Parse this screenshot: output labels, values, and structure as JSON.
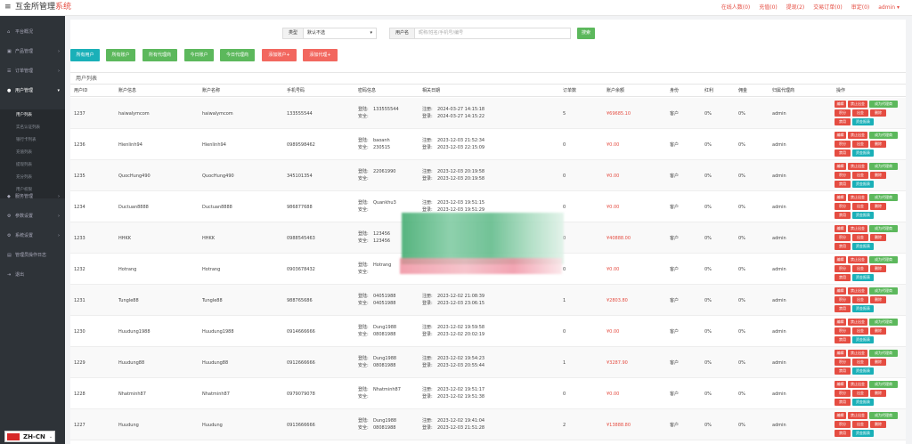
{
  "header": {
    "brand_main": "互金所管理",
    "brand_accent": "系统",
    "links": [
      "在线人数(0)",
      "充值(0)",
      "提现(2)",
      "交易订单(0)",
      "审定(0)"
    ],
    "user": "admin"
  },
  "sidebar": {
    "items": [
      {
        "label": "平台概况",
        "icon": "home-icon"
      },
      {
        "label": "产品管理",
        "icon": "box-icon"
      },
      {
        "label": "订单管理",
        "icon": "list-icon"
      },
      {
        "label": "用户管理",
        "icon": "user-icon"
      },
      {
        "label": "服务管理",
        "icon": "service-icon"
      },
      {
        "label": "参数设置",
        "icon": "gear-icon"
      },
      {
        "label": "系统设置",
        "icon": "settings-icon"
      },
      {
        "label": "管理员操作日志",
        "icon": "log-icon"
      },
      {
        "label": "退出",
        "icon": "logout-icon"
      }
    ],
    "subitems": [
      "用户列表",
      "实名认证列表",
      "银行卡列表",
      "充值列表",
      "提现列表",
      "充分列表",
      "用户权限"
    ]
  },
  "filter": {
    "type_label": "类型",
    "type_value": "默认不选",
    "user_label": "用户名",
    "search_placeholder": "昵称/姓名/手机号/编号",
    "search_button": "搜索"
  },
  "actions": [
    "所有用户",
    "所有账户",
    "所有代理商",
    "今日账户",
    "今日代理商",
    "添加账户+",
    "添加代理+"
  ],
  "table": {
    "title": "用户列表",
    "headers": [
      "用户ID",
      "账户信息",
      "账户名称",
      "手机号码",
      "密码信息",
      "相关日期",
      "订单数",
      "账户余额",
      "身份",
      "红利",
      "佣金",
      "归属代理商",
      "操作"
    ],
    "op_buttons": [
      "编辑",
      "禁止出金",
      "成为代理商",
      "积分",
      "出金",
      "删除",
      "禁用",
      "资金报表"
    ],
    "login_label": "登陆:",
    "safe_label": "安全:",
    "reg_label": "注册:",
    "signin_label": "登录:",
    "rows": [
      {
        "id": "1237",
        "account": "haiwalymcom",
        "name": "haiwalymcom",
        "phone": "133555544",
        "pw_login": "133555544",
        "pw_safe": "",
        "reg": "2024-03-27 14:15:18",
        "login": "2024-03-27 14:15:22",
        "orders": "5",
        "balance": "¥69685.10",
        "role": "客户",
        "bonus": "0%",
        "commission": "0%",
        "agent": "admin"
      },
      {
        "id": "1236",
        "account": "Hienlinh94",
        "name": "Hienlinh94",
        "phone": "0989598462",
        "pw_login": "baoanh",
        "pw_safe": "230515",
        "reg": "2023-12-03 21:52:34",
        "login": "2023-12-03 22:15:09",
        "orders": "0",
        "balance": "¥0.00",
        "role": "客户",
        "bonus": "0%",
        "commission": "0%",
        "agent": "admin"
      },
      {
        "id": "1235",
        "account": "QuocHung490",
        "name": "QuocHung490",
        "phone": "345101354",
        "pw_login": "22061990",
        "pw_safe": "",
        "reg": "2023-12-03 20:19:58",
        "login": "2023-12-03 20:19:58",
        "orders": "0",
        "balance": "¥0.00",
        "role": "客户",
        "bonus": "0%",
        "commission": "0%",
        "agent": "admin"
      },
      {
        "id": "1234",
        "account": "Ductuan8888",
        "name": "Ductuan8888",
        "phone": "986877688",
        "pw_login": "Quankhu3",
        "pw_safe": "",
        "reg": "2023-12-03 19:51:15",
        "login": "2023-12-03 19:51:29",
        "orders": "0",
        "balance": "¥0.00",
        "role": "客户",
        "bonus": "0%",
        "commission": "0%",
        "agent": "admin"
      },
      {
        "id": "1233",
        "account": "HHKK",
        "name": "HHKK",
        "phone": "0988545463",
        "pw_login": "123456",
        "pw_safe": "123456",
        "reg": "",
        "login": "",
        "orders": "0",
        "balance": "¥40888.00",
        "role": "客户",
        "bonus": "0%",
        "commission": "0%",
        "agent": "admin"
      },
      {
        "id": "1232",
        "account": "Hotrang",
        "name": "Hotrang",
        "phone": "0903678432",
        "pw_login": "Hotrang",
        "pw_safe": "",
        "reg": "",
        "login": "",
        "orders": "0",
        "balance": "¥0.00",
        "role": "客户",
        "bonus": "0%",
        "commission": "0%",
        "agent": "admin"
      },
      {
        "id": "1231",
        "account": "Tungle88",
        "name": "Tungle88",
        "phone": "988765686",
        "pw_login": "04051988",
        "pw_safe": "04051988",
        "reg": "2023-12-02 21:08:39",
        "login": "2023-12-03 23:06:15",
        "orders": "1",
        "balance": "¥2803.80",
        "role": "客户",
        "bonus": "0%",
        "commission": "0%",
        "agent": "admin"
      },
      {
        "id": "1230",
        "account": "Huudung1988",
        "name": "Huudung1988",
        "phone": "0914666666",
        "pw_login": "Dung1988",
        "pw_safe": "08081988",
        "reg": "2023-12-02 19:59:58",
        "login": "2023-12-02 20:02:19",
        "orders": "0",
        "balance": "¥0.00",
        "role": "客户",
        "bonus": "0%",
        "commission": "0%",
        "agent": "admin"
      },
      {
        "id": "1229",
        "account": "Huudung88",
        "name": "Huudung88",
        "phone": "0912666666",
        "pw_login": "Dung1988",
        "pw_safe": "08081988",
        "reg": "2023-12-02 19:54:23",
        "login": "2023-12-03 20:55:44",
        "orders": "1",
        "balance": "¥3287.90",
        "role": "客户",
        "bonus": "0%",
        "commission": "0%",
        "agent": "admin"
      },
      {
        "id": "1228",
        "account": "Nhatminh87",
        "name": "Nhatminh87",
        "phone": "0979079078",
        "pw_login": "Nhatminh87",
        "pw_safe": "",
        "reg": "2023-12-02 19:51:17",
        "login": "2023-12-02 19:51:38",
        "orders": "0",
        "balance": "¥0.00",
        "role": "客户",
        "bonus": "0%",
        "commission": "0%",
        "agent": "admin"
      },
      {
        "id": "1227",
        "account": "Huudung",
        "name": "Huudung",
        "phone": "0913666666",
        "pw_login": "Dung1988",
        "pw_safe": "08081988",
        "reg": "2023-12-02 19:41:04",
        "login": "2023-12-03 21:51:28",
        "orders": "2",
        "balance": "¥13888.80",
        "role": "客户",
        "bonus": "0%",
        "commission": "0%",
        "agent": "admin"
      }
    ]
  },
  "language": {
    "label": "ZH-CN"
  },
  "colors": {
    "accent": "#e54d42",
    "green": "#5cb85c",
    "teal": "#1ab0b8",
    "sidebar": "#2e3338"
  }
}
